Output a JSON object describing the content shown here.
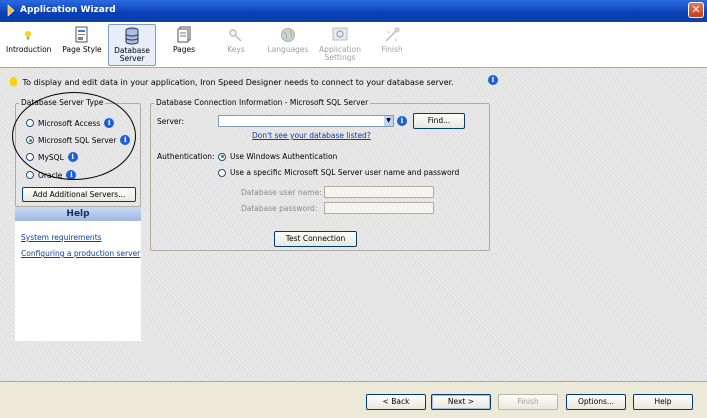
{
  "window": {
    "title": "Application Wizard"
  },
  "toolbar": {
    "items": [
      {
        "label": "Introduction",
        "icon": "lightbulb-icon",
        "state": "normal"
      },
      {
        "label": "Page Style",
        "icon": "page-style-icon",
        "state": "normal"
      },
      {
        "label": "Database Server",
        "icon": "database-icon",
        "state": "active"
      },
      {
        "label": "Pages",
        "icon": "pages-icon",
        "state": "normal"
      },
      {
        "label": "Keys",
        "icon": "keys-icon",
        "state": "disabled"
      },
      {
        "label": "Languages",
        "icon": "globe-icon",
        "state": "disabled"
      },
      {
        "label": "Application Settings",
        "icon": "settings-icon",
        "state": "disabled"
      },
      {
        "label": "Finish",
        "icon": "finish-icon",
        "state": "disabled"
      }
    ]
  },
  "info": {
    "text": "To display and edit data in your application, Iron Speed Designer needs to connect to your database server."
  },
  "server_type": {
    "legend": "Database Server Type",
    "options": [
      {
        "label": "Microsoft Access",
        "checked": false
      },
      {
        "label": "Microsoft SQL Server",
        "checked": true
      },
      {
        "label": "MySQL",
        "checked": false
      },
      {
        "label": "Oracle",
        "checked": false
      }
    ],
    "add_button": "Add Additional Servers..."
  },
  "help": {
    "title": "Help",
    "links": [
      "System requirements",
      "Configuring a production server"
    ]
  },
  "connection": {
    "legend": "Database Connection Information - Microsoft SQL Server",
    "server_label": "Server:",
    "server_value": "",
    "find_button": "Find...",
    "not_listed_link": "Don't see your database listed?",
    "auth_label": "Authentication:",
    "auth_windows": "Use Windows Authentication",
    "auth_sql": "Use a specific Microsoft SQL Server user name and password",
    "user_label": "Database user name:",
    "password_label": "Database password:",
    "test_button": "Test Connection"
  },
  "footer": {
    "back": "< Back",
    "next": "Next >",
    "finish": "Finish",
    "options": "Options...",
    "help": "Help"
  },
  "colors": {
    "titlebar": "#0a3fb8",
    "info_icon": "#1c5fd6",
    "link": "#0b3ca6"
  }
}
